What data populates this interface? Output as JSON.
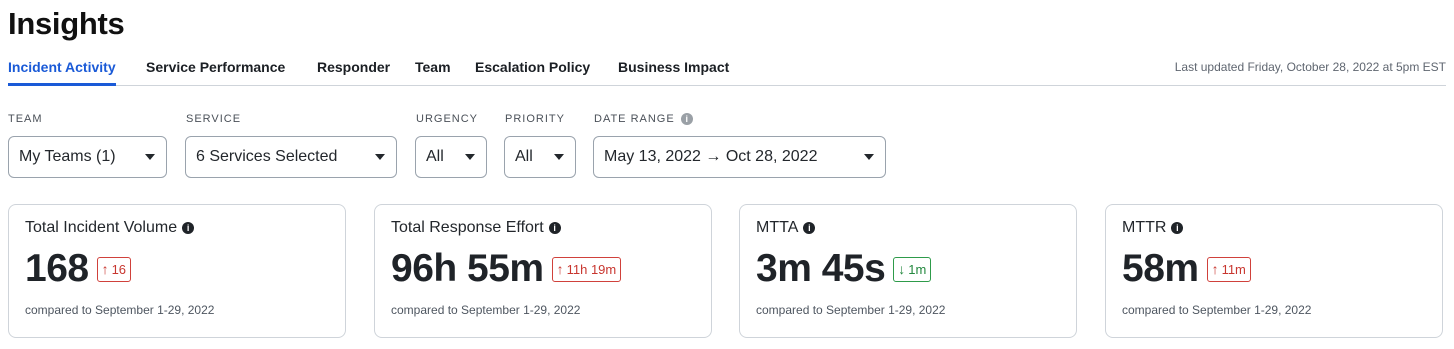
{
  "page": {
    "title": "Insights"
  },
  "tabs": [
    {
      "label": "Incident Activity",
      "active": true
    },
    {
      "label": "Service Performance"
    },
    {
      "label": "Responder"
    },
    {
      "label": "Team"
    },
    {
      "label": "Escalation Policy"
    },
    {
      "label": "Business Impact"
    }
  ],
  "last_updated": "Last updated Friday, October 28, 2022 at 5pm EST",
  "filters": {
    "team": {
      "label": "TEAM",
      "value": "My Teams (1)"
    },
    "service": {
      "label": "SERVICE",
      "value": "6 Services Selected"
    },
    "urgency": {
      "label": "URGENCY",
      "value": "All"
    },
    "priority": {
      "label": "PRIORITY",
      "value": "All"
    },
    "date_range": {
      "label": "DATE RANGE",
      "value": "May 13, 2022 → Oct 28, 2022"
    }
  },
  "icons": {
    "info": "i",
    "arrow_up": "↑",
    "arrow_down": "↓"
  },
  "cards": [
    {
      "title": "Total Incident Volume",
      "value": "168",
      "delta": "16",
      "direction": "up",
      "compare": "compared to September 1-29, 2022"
    },
    {
      "title": "Total Response Effort",
      "value": "96h 55m",
      "delta": "11h 19m",
      "direction": "up",
      "compare": "compared to September 1-29, 2022"
    },
    {
      "title": "MTTA",
      "value": "3m 45s",
      "delta": "1m",
      "direction": "down",
      "compare": "compared to September 1-29, 2022"
    },
    {
      "title": "MTTR",
      "value": "58m",
      "delta": "11m",
      "direction": "up",
      "compare": "compared to September 1-29, 2022"
    }
  ],
  "colors": {
    "accent": "#1a5ad7",
    "delta_up": "#c8362f",
    "delta_down": "#23883e"
  }
}
